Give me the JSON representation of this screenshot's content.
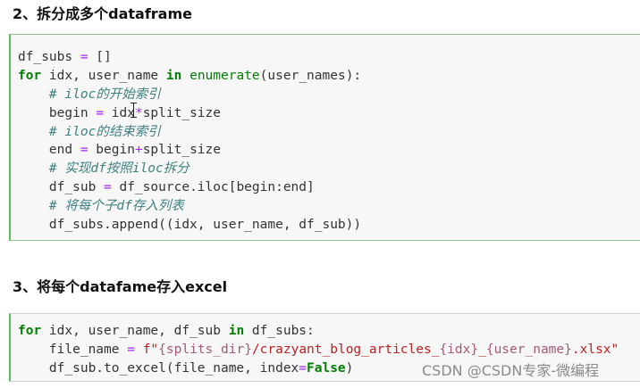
{
  "sections": [
    {
      "heading": "2、拆分成多个dataframe"
    },
    {
      "heading": "3、将每个datafame存入excel"
    }
  ],
  "cell1": {
    "l1": {
      "a": "df_subs ",
      "b": "=",
      "c": " []"
    },
    "l2": {
      "kw1": "for",
      "a": " idx, user_name ",
      "kw2": "in",
      "a2": " ",
      "fn": "enumerate",
      "b": "(user_names):"
    },
    "l3": {
      "indent": "    ",
      "cm": "# iloc的开始索引"
    },
    "l4": {
      "indent": "    ",
      "a": "begin ",
      "op1": "=",
      "b": " idx",
      "op2": "*",
      "c": "split_size"
    },
    "l5": {
      "indent": "    ",
      "cm": "# iloc的结束索引"
    },
    "l6": {
      "indent": "    ",
      "a": "end ",
      "op1": "=",
      "b": " begin",
      "op2": "+",
      "c": "split_size"
    },
    "l7": {
      "indent": "    ",
      "cm": "# 实现df按照iloc拆分"
    },
    "l8": {
      "indent": "    ",
      "a": "df_sub ",
      "op1": "=",
      "b": " df_source.iloc[begin:end]"
    },
    "l9": {
      "indent": "    ",
      "cm": "# 将每个子df存入列表"
    },
    "l10": {
      "indent": "    ",
      "a": "df_subs.append((idx, user_name, df_sub))"
    }
  },
  "cell2": {
    "l1": {
      "kw1": "for",
      "a": " idx, user_name, df_sub ",
      "kw2": "in",
      "b": " df_subs:"
    },
    "l2": {
      "indent": "    ",
      "a": "file_name ",
      "op1": "=",
      "a2": " ",
      "pre": "f\"",
      "i1": "{splits_dir}",
      "s1": "/crazyant_blog_articles_",
      "i2": "{idx}",
      "s2": "_",
      "i3": "{user_name}",
      "s3": ".xlsx\""
    },
    "l3": {
      "indent": "    ",
      "a": "df_sub.to_excel(file_name, index",
      "op1": "=",
      "kc": "False",
      "b": ")"
    }
  },
  "watermark": "CSDN @CSDN专家-微编程"
}
